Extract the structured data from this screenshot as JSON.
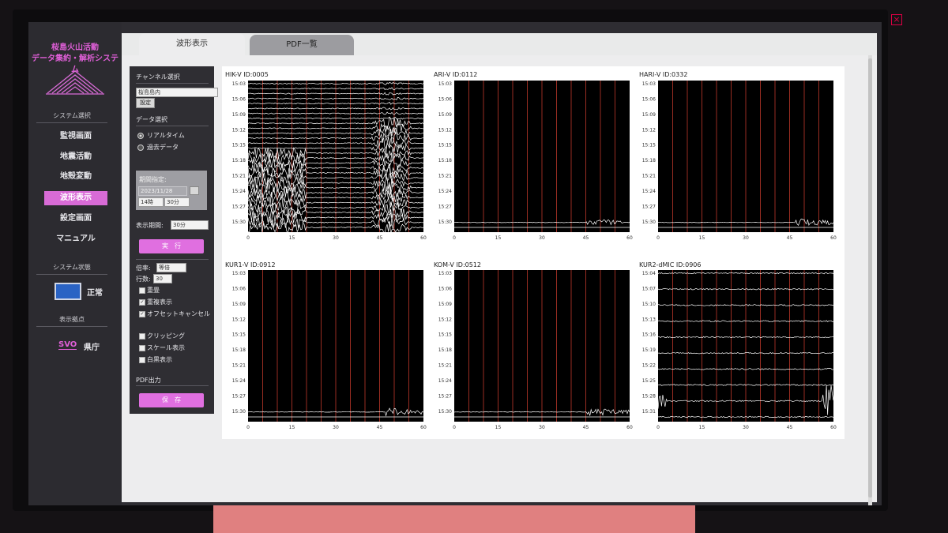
{
  "app": {
    "title_line1": "桜島火山活動",
    "title_line2": "データ集約・解析システム",
    "close_glyph": "×"
  },
  "nav": {
    "system_select_label": "システム選択",
    "items": [
      {
        "label": "監視画面"
      },
      {
        "label": "地震活動"
      },
      {
        "label": "地殻変動"
      },
      {
        "label": "波形表示",
        "active": true
      },
      {
        "label": "設定画面"
      },
      {
        "label": "マニュアル"
      }
    ],
    "system_status_label": "システム状態",
    "status_text": "正常",
    "display_base_label": "表示拠点",
    "stations": [
      {
        "label": "SVO",
        "active": true
      },
      {
        "label": "県庁",
        "active": false
      }
    ]
  },
  "tabs": [
    {
      "label": "波形表示",
      "active": true
    },
    {
      "label": "PDF一覧",
      "active": false
    }
  ],
  "controls": {
    "channel_select_label": "チャンネル選択",
    "channel_value": "桜島島内",
    "set_button": "設定",
    "data_select_label": "データ選択",
    "radio_realtime": "リアルタイム",
    "radio_past": "過去データ",
    "period_label": "期間指定:",
    "date_value": "2023/11/28",
    "hour_value": "14時",
    "minute_value": "30分",
    "display_period_label": "表示期間:",
    "display_period_value": "30分",
    "execute_button": "実　行",
    "magnification_label": "倍率:",
    "magnification_value": "等倍",
    "rows_label": "行数:",
    "rows_value": "30",
    "checkboxes": [
      {
        "label": "重畳",
        "checked": false
      },
      {
        "label": "重複表示",
        "checked": true
      },
      {
        "label": "オフセットキャンセル",
        "checked": true
      },
      {
        "label": "クリッピング",
        "checked": false
      },
      {
        "label": "スケール表示",
        "checked": false
      },
      {
        "label": "白黒表示",
        "checked": false
      }
    ],
    "pdf_output_label": "PDF出力",
    "save_button": "保　存"
  },
  "chart_data": [
    {
      "type": "line",
      "title": "HIK-V ID:0005",
      "y_ticks": [
        "15:03",
        "15:06",
        "15:09",
        "15:12",
        "15:15",
        "15:18",
        "15:21",
        "15:24",
        "15:27",
        "15:30"
      ],
      "x_ticks": [
        "0",
        "15",
        "30",
        "45",
        "60"
      ],
      "xlim": [
        0,
        60
      ],
      "rows": 30,
      "activity": "heavy",
      "event_x": [
        2,
        48
      ]
    },
    {
      "type": "line",
      "title": "ARI-V ID:0112",
      "y_ticks": [
        "15:03",
        "15:06",
        "15:09",
        "15:12",
        "15:15",
        "15:18",
        "15:21",
        "15:24",
        "15:27",
        "15:30"
      ],
      "x_ticks": [
        "0",
        "15",
        "30",
        "45",
        "60"
      ],
      "xlim": [
        0,
        60
      ],
      "rows": 30,
      "activity": "event",
      "event_x": [
        45,
        58
      ]
    },
    {
      "type": "line",
      "title": "HARI-V ID:0332",
      "y_ticks": [
        "15:03",
        "15:06",
        "15:09",
        "15:12",
        "15:15",
        "15:18",
        "15:21",
        "15:24",
        "15:27",
        "15:30"
      ],
      "x_ticks": [
        "0",
        "15",
        "30",
        "45",
        "60"
      ],
      "xlim": [
        0,
        60
      ],
      "rows": 30,
      "activity": "event",
      "event_x": [
        47,
        60
      ]
    },
    {
      "type": "line",
      "title": "KUR1-V ID:0912",
      "y_ticks": [
        "15:03",
        "15:06",
        "15:09",
        "15:12",
        "15:15",
        "15:18",
        "15:21",
        "15:24",
        "15:27",
        "15:30"
      ],
      "x_ticks": [
        "0",
        "15",
        "30",
        "45",
        "60"
      ],
      "xlim": [
        0,
        60
      ],
      "rows": 30,
      "activity": "event",
      "event_x": [
        47,
        60
      ]
    },
    {
      "type": "line",
      "title": "KOM-V ID:0512",
      "y_ticks": [
        "15:03",
        "15:06",
        "15:09",
        "15:12",
        "15:15",
        "15:18",
        "15:21",
        "15:24",
        "15:27",
        "15:30"
      ],
      "x_ticks": [
        "0",
        "15",
        "30",
        "45",
        "60"
      ],
      "xlim": [
        0,
        60
      ],
      "rows": 30,
      "activity": "event",
      "event_x": [
        45,
        60
      ]
    },
    {
      "type": "line",
      "title": "KUR2-dMIC ID:0906",
      "y_ticks": [
        "15:04",
        "15:07",
        "15:10",
        "15:13",
        "15:16",
        "15:19",
        "15:22",
        "15:25",
        "15:28",
        "15:31"
      ],
      "x_ticks": [
        "0",
        "15",
        "30",
        "45",
        "60"
      ],
      "xlim": [
        0,
        60
      ],
      "rows": 10,
      "activity": "infrasound",
      "event_x": [
        1,
        57
      ]
    }
  ],
  "colors": {
    "accent": "#d86bd6",
    "grid_red": "#c0392b",
    "trace": "#ffffff",
    "plot_bg": "#000000"
  }
}
